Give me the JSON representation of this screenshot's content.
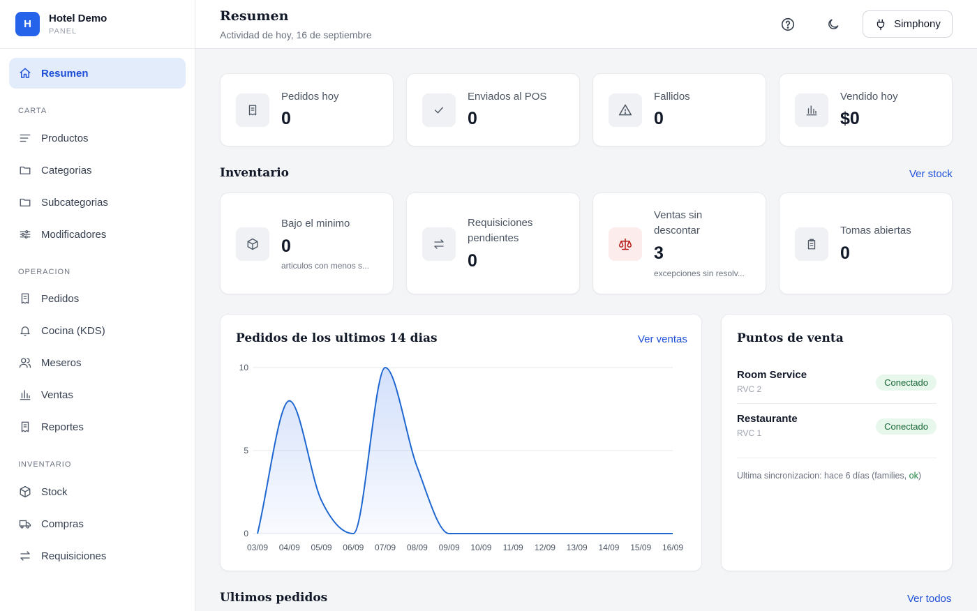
{
  "brand": {
    "logo_letter": "H",
    "title": "Hotel Demo",
    "subtitle": "PANEL"
  },
  "sidebar": {
    "active": {
      "label": "Resumen",
      "icon": "home-icon"
    },
    "sections": [
      {
        "label": "CARTA",
        "items": [
          {
            "label": "Productos",
            "icon": "list-icon"
          },
          {
            "label": "Categorias",
            "icon": "folder-icon"
          },
          {
            "label": "Subcategorias",
            "icon": "folder-icon"
          },
          {
            "label": "Modificadores",
            "icon": "sliders-icon"
          }
        ]
      },
      {
        "label": "OPERACION",
        "items": [
          {
            "label": "Pedidos",
            "icon": "receipt-icon"
          },
          {
            "label": "Cocina (KDS)",
            "icon": "bell-icon"
          },
          {
            "label": "Meseros",
            "icon": "users-icon"
          },
          {
            "label": "Ventas",
            "icon": "bar-chart-icon"
          },
          {
            "label": "Reportes",
            "icon": "receipt-icon"
          }
        ]
      },
      {
        "label": "INVENTARIO",
        "items": [
          {
            "label": "Stock",
            "icon": "box-icon"
          },
          {
            "label": "Compras",
            "icon": "truck-icon"
          },
          {
            "label": "Requisiciones",
            "icon": "swap-icon"
          }
        ]
      }
    ]
  },
  "header": {
    "title": "Resumen",
    "subtitle": "Actividad de hoy, 16 de septiembre",
    "help_icon": "help-circle-icon",
    "theme_icon": "moon-icon",
    "simphony_label": "Simphony",
    "simphony_icon": "plug-icon"
  },
  "stats": [
    {
      "label": "Pedidos hoy",
      "value": "0",
      "icon": "receipt-icon"
    },
    {
      "label": "Enviados al POS",
      "value": "0",
      "icon": "check-icon"
    },
    {
      "label": "Fallidos",
      "value": "0",
      "icon": "alert-triangle-icon"
    },
    {
      "label": "Vendido hoy",
      "value": "$0",
      "icon": "bar-chart-icon"
    }
  ],
  "inventory": {
    "title": "Inventario",
    "link": "Ver stock",
    "cards": [
      {
        "label": "Bajo el minimo",
        "value": "0",
        "note": "articulos con menos s...",
        "icon": "box-icon"
      },
      {
        "label_line1": "Requisiciones",
        "label_line2": "pendientes",
        "value": "0",
        "icon": "swap-icon"
      },
      {
        "label_line1": "Ventas sin",
        "label_line2": "descontar",
        "value": "3",
        "note": "excepciones sin resolv...",
        "icon": "scale-icon",
        "icon_color": "#b91c1c"
      },
      {
        "label": "Tomas abiertas",
        "value": "0",
        "icon": "clipboard-icon"
      }
    ]
  },
  "orders_chart": {
    "title": "Pedidos de los ultimos 14 dias",
    "link": "Ver ventas"
  },
  "chart_data": {
    "type": "area",
    "categories": [
      "03/09",
      "04/09",
      "05/09",
      "06/09",
      "07/09",
      "08/09",
      "09/09",
      "10/09",
      "11/09",
      "12/09",
      "13/09",
      "14/09",
      "15/09",
      "16/09"
    ],
    "values": [
      0,
      8,
      2,
      0,
      10,
      4,
      0,
      0,
      0,
      0,
      0,
      0,
      0,
      0
    ],
    "yticks": [
      "0",
      "5",
      "10"
    ],
    "ylim": [
      0,
      10
    ],
    "grid": true,
    "line_color": "#1e66d0"
  },
  "pos": {
    "title": "Puntos de venta",
    "items": [
      {
        "name": "Room Service",
        "code": "RVC 2",
        "status": "Conectado"
      },
      {
        "name": "Restaurante",
        "code": "RVC 1",
        "status": "Conectado"
      }
    ],
    "sync_prefix": "Ultima sincronizacion: hace 6 días (families, ",
    "sync_ok": "ok",
    "sync_suffix": ")"
  },
  "latest_orders": {
    "title": "Ultimos pedidos",
    "link": "Ver todos"
  }
}
